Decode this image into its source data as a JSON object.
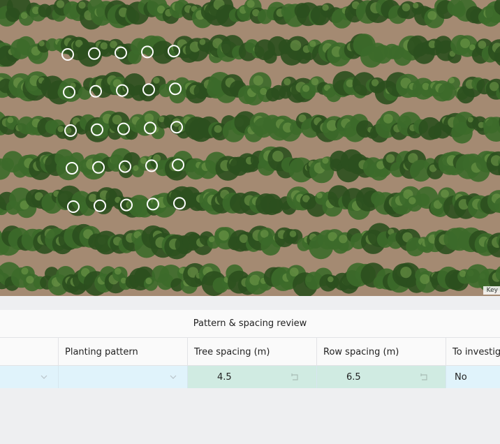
{
  "map": {
    "attribution": "Key",
    "colors": {
      "soil": "#a48a72",
      "canopy_dark": "#2b4f1e",
      "canopy_light": "#6f9a4a",
      "marker": "#ffffff"
    },
    "marker_grid": {
      "rows": 5,
      "cols": 5
    }
  },
  "table": {
    "group_header": "Pattern & spacing review",
    "columns": [
      "",
      "Planting pattern",
      "Tree spacing (m)",
      "Row spacing (m)",
      "To investigate"
    ],
    "row": {
      "col0": "",
      "planting_pattern": "",
      "tree_spacing": "4.5",
      "row_spacing": "6.5",
      "to_investigate": "No"
    }
  },
  "icons": {
    "dropdown": "chevron-down-icon",
    "revert": "undo-icon"
  }
}
